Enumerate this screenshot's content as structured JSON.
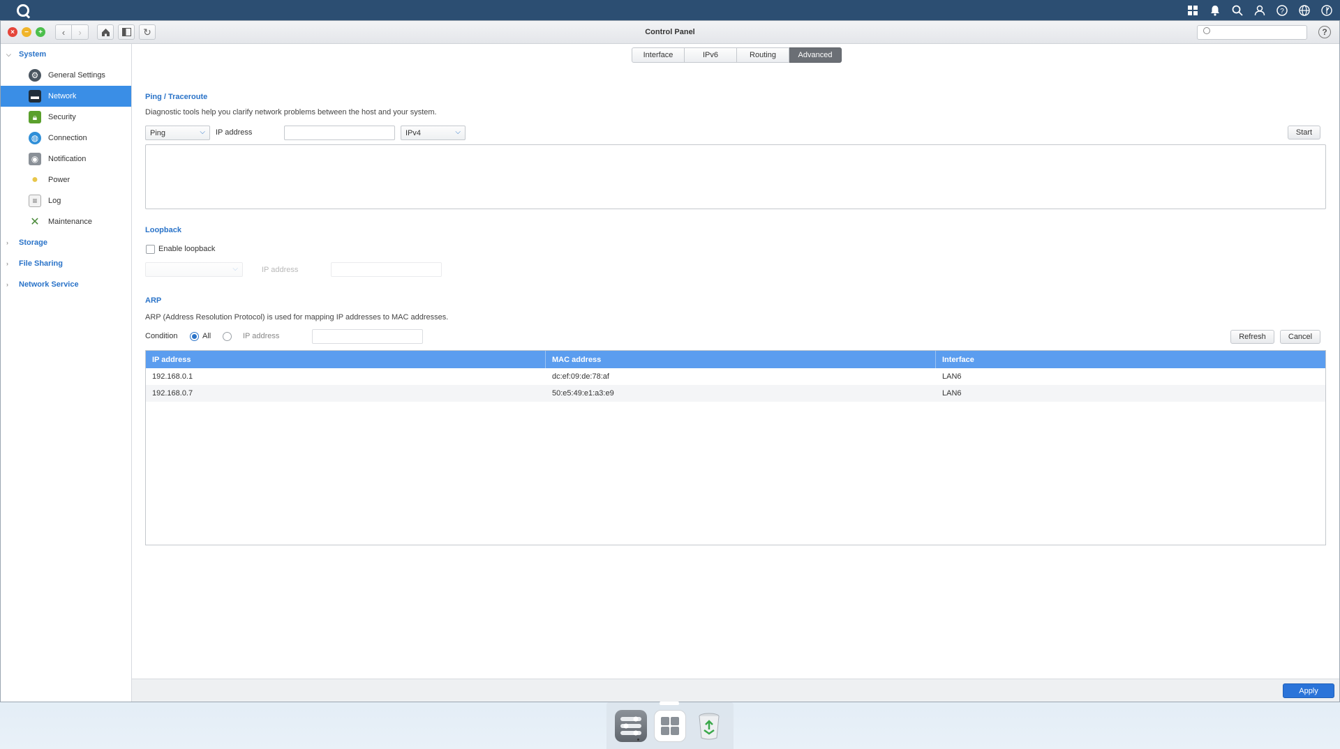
{
  "window": {
    "title": "Control Panel",
    "search_placeholder": ""
  },
  "sidebar": {
    "groups": [
      {
        "label": "System"
      },
      {
        "label": "Storage"
      },
      {
        "label": "File Sharing"
      },
      {
        "label": "Network Service"
      }
    ],
    "items": [
      {
        "label": "General Settings",
        "icon": "gear-icon"
      },
      {
        "label": "Network",
        "icon": "network-icon"
      },
      {
        "label": "Security",
        "icon": "lock-icon"
      },
      {
        "label": "Connection",
        "icon": "globe-icon"
      },
      {
        "label": "Notification",
        "icon": "bell-icon"
      },
      {
        "label": "Power",
        "icon": "bulb-icon"
      },
      {
        "label": "Log",
        "icon": "log-icon"
      },
      {
        "label": "Maintenance",
        "icon": "tools-icon"
      }
    ]
  },
  "tabs": [
    {
      "label": "Interface"
    },
    {
      "label": "IPv6"
    },
    {
      "label": "Routing"
    },
    {
      "label": "Advanced"
    }
  ],
  "ping": {
    "title": "Ping / Traceroute",
    "description": "Diagnostic tools help you clarify network problems between the host and your system.",
    "tool_value": "Ping",
    "ip_label": "IP address",
    "ip_value": "",
    "protocol_value": "IPv4",
    "start_label": "Start"
  },
  "loopback": {
    "title": "Loopback",
    "enable_label": "Enable loopback",
    "ip_label": "IP address"
  },
  "arp": {
    "title": "ARP",
    "description": "ARP (Address Resolution Protocol) is used for mapping IP addresses to MAC addresses.",
    "condition_label": "Condition",
    "all_label": "All",
    "ip_label": "IP address",
    "refresh_label": "Refresh",
    "cancel_label": "Cancel",
    "columns": [
      "IP address",
      "MAC address",
      "Interface"
    ],
    "rows": [
      [
        "192.168.0.1",
        "dc:ef:09:de:78:af",
        "LAN6"
      ],
      [
        "192.168.0.7",
        "50:e5:49:e1:a3:e9",
        "LAN6"
      ]
    ]
  },
  "footer": {
    "apply_label": "Apply"
  },
  "colors": {
    "accent": "#2a73c8",
    "header": "#5b9def",
    "active": "#3a8ee6",
    "taskbar": "#2c4e72"
  }
}
